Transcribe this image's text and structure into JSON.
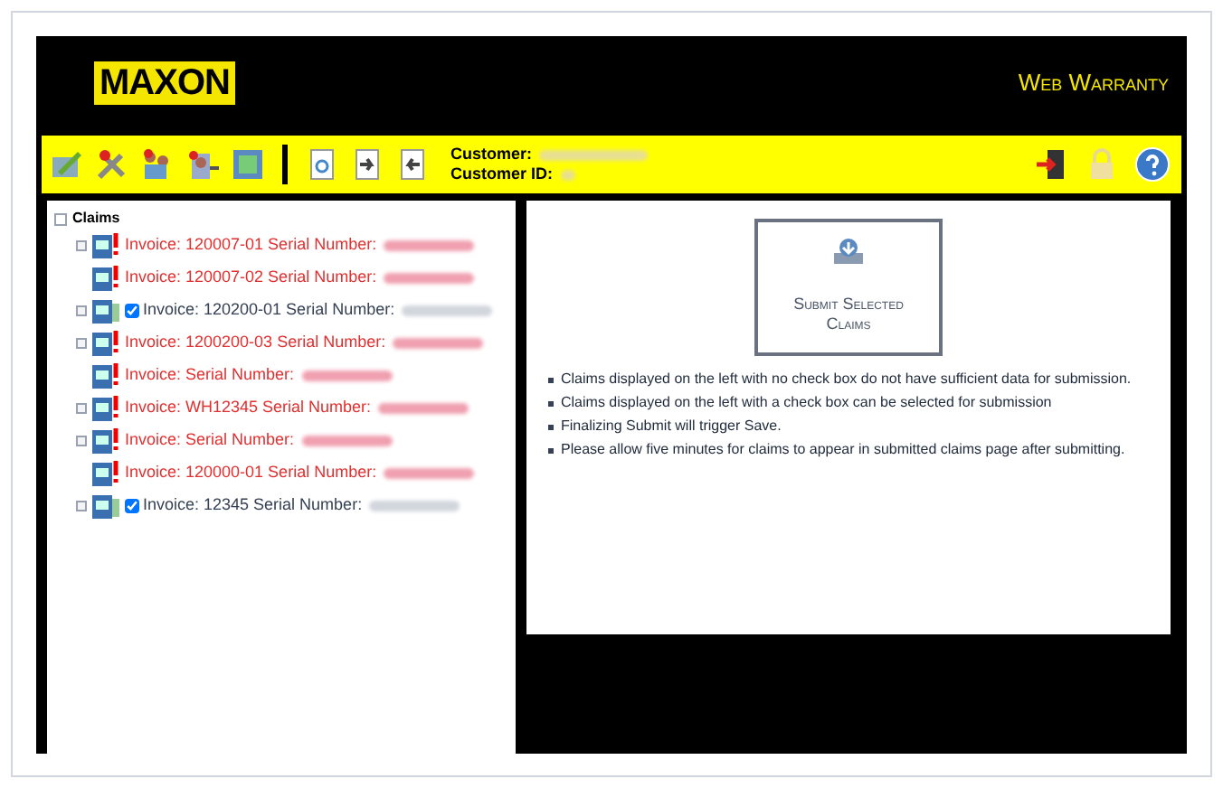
{
  "header": {
    "logo": "MAXON",
    "title": "Web Warranty"
  },
  "toolbar": {
    "customer_label": "Customer:",
    "customer_id_label": "Customer ID:"
  },
  "tree": {
    "label": "Claims",
    "expanded": true,
    "children": [
      {
        "kind": "error",
        "text": "Invoice: 120007-01 Serial Number:",
        "expandable": true
      },
      {
        "kind": "error",
        "text": "Invoice: 120007-02 Serial Number:",
        "expandable": false
      },
      {
        "kind": "checkable",
        "text": "Invoice: 120200-01 Serial Number:",
        "expandable": true,
        "checked": true
      },
      {
        "kind": "error",
        "text": "Invoice: 1200200-03 Serial Number:",
        "expandable": true
      },
      {
        "kind": "error",
        "text": "Invoice: Serial Number:",
        "expandable": false
      },
      {
        "kind": "error",
        "text": "Invoice: WH12345 Serial Number:",
        "expandable": true
      },
      {
        "kind": "error",
        "text": "Invoice: Serial Number:",
        "expandable": true
      },
      {
        "kind": "error",
        "text": "Invoice: 120000-01 Serial Number:",
        "expandable": false
      },
      {
        "kind": "checkable",
        "text": "Invoice: 12345 Serial Number:",
        "expandable": true,
        "checked": true
      }
    ]
  },
  "submit_button": "Submit Selected Claims",
  "notes": [
    "Claims displayed on the left with no check box do not have sufficient data for submission.",
    "Claims displayed on the left with a check box can be selected for submission",
    "Finalizing Submit will trigger Save.",
    "Please allow five minutes for claims to appear in submitted claims page after submitting."
  ]
}
